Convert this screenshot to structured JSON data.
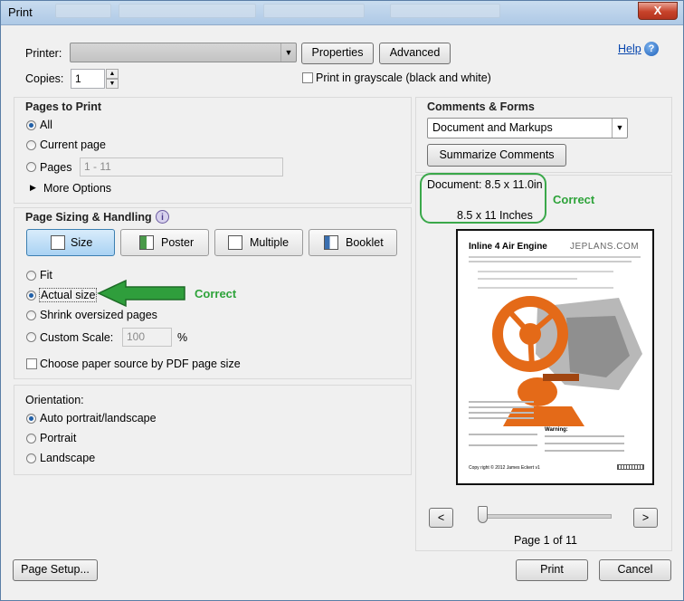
{
  "window": {
    "title": "Print",
    "close_glyph": "X"
  },
  "printer": {
    "label": "Printer:",
    "value": "",
    "properties_label": "Properties",
    "advanced_label": "Advanced",
    "help_label": "Help"
  },
  "copies": {
    "label": "Copies:",
    "value": "1"
  },
  "grayscale": {
    "label": "Print in grayscale (black and white)",
    "checked": false
  },
  "pages_to_print": {
    "heading": "Pages to Print",
    "all": "All",
    "current": "Current page",
    "pages": "Pages",
    "pages_value": "1 - 11",
    "more_options": "More Options"
  },
  "sizing": {
    "heading": "Page Sizing & Handling",
    "tabs": [
      "Size",
      "Poster",
      "Multiple",
      "Booklet"
    ],
    "fit": "Fit",
    "actual": "Actual size",
    "shrink": "Shrink oversized pages",
    "custom": "Custom Scale:",
    "custom_value": "100",
    "percent": "%",
    "paper_source": "Choose paper source by PDF page size"
  },
  "orientation": {
    "heading": "Orientation:",
    "auto": "Auto portrait/landscape",
    "portrait": "Portrait",
    "landscape": "Landscape"
  },
  "comments": {
    "heading": "Comments & Forms",
    "value": "Document and Markups",
    "summarize": "Summarize Comments"
  },
  "document_info": {
    "size_line": "Document: 8.5 x 11.0in",
    "paper_line": "8.5 x 11 Inches"
  },
  "annotations": {
    "correct_top": "Correct",
    "correct_left": "Correct"
  },
  "preview_page": {
    "title": "Inline 4 Air Engine",
    "brand": "JEPLANS.COM",
    "copyright": "Copy right © 2012 James Eckert v1",
    "warning_head": "Warning:"
  },
  "navigation": {
    "prev": "<",
    "next": ">",
    "page_label": "Page 1 of 11",
    "slider_fraction": 0.0
  },
  "footer": {
    "page_setup": "Page Setup...",
    "print": "Print",
    "cancel": "Cancel"
  },
  "colors": {
    "callout_green": "#2ea33a",
    "accent_blue": "#1f5fa8"
  }
}
